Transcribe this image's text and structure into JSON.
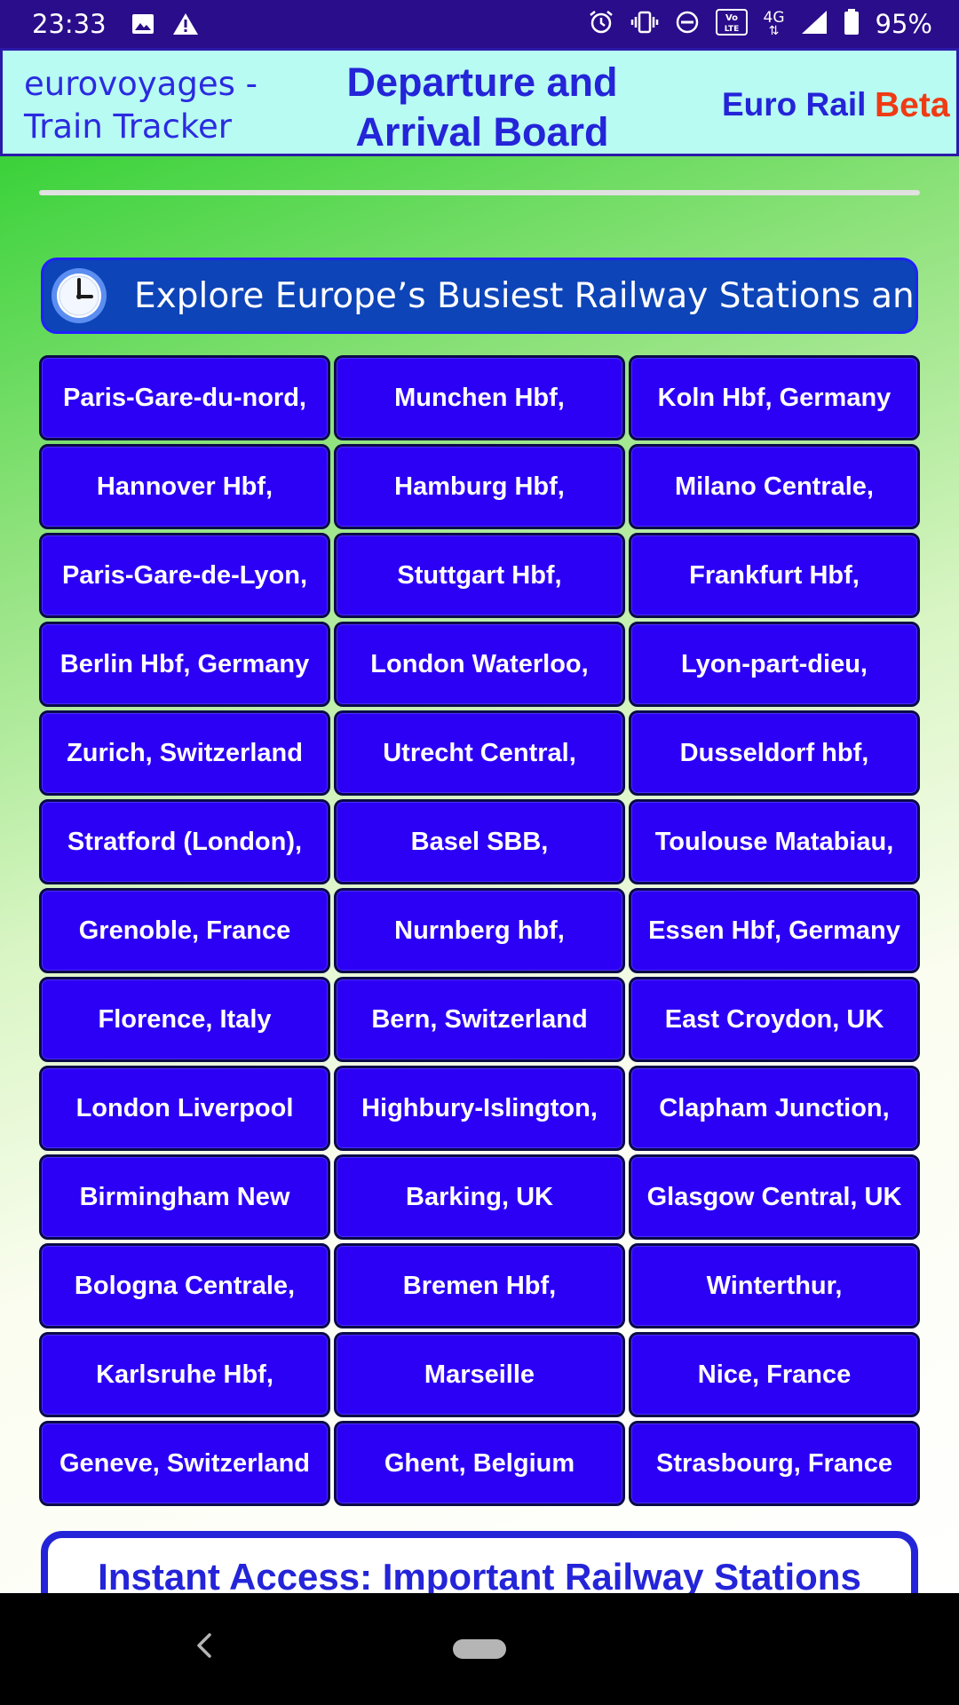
{
  "status_bar": {
    "time": "23:33",
    "battery": "95%",
    "network": "4G",
    "volte": "Vo LTE",
    "icons": [
      "image-icon",
      "warning-icon",
      "alarm-icon",
      "vibrate-icon",
      "do-not-disturb-icon",
      "volte-icon",
      "network-4g-icon",
      "signal-icon",
      "battery-icon"
    ]
  },
  "header": {
    "brand_line1": "eurovoyages -",
    "brand_line2": "Train Tracker",
    "title_line1": "Departure and",
    "title_line2": "Arrival Board",
    "euro_rail": "Euro Rail",
    "beta": "Beta"
  },
  "banner": {
    "text": "Explore Europe’s Busiest Railway Stations and Access"
  },
  "stations": [
    "Paris-Gare-du-nord,",
    "Munchen Hbf,",
    "Koln Hbf, Germany",
    "Hannover Hbf,",
    "Hamburg Hbf,",
    "Milano Centrale,",
    "Paris-Gare-de-Lyon,",
    "Stuttgart Hbf,",
    "Frankfurt Hbf,",
    "Berlin Hbf, Germany",
    "London Waterloo,",
    "Lyon-part-dieu,",
    "Zurich, Switzerland",
    "Utrecht Central,",
    "Dusseldorf hbf,",
    "Stratford (London),",
    "Basel SBB,",
    "Toulouse Matabiau,",
    "Grenoble, France",
    "Nurnberg hbf,",
    "Essen Hbf, Germany",
    "Florence, Italy",
    "Bern, Switzerland",
    "East Croydon, UK",
    "London Liverpool",
    "Highbury-Islington,",
    "Clapham Junction,",
    "Birmingham New",
    "Barking, UK",
    "Glasgow Central, UK",
    "Bologna Centrale,",
    "Bremen Hbf,",
    "Winterthur,",
    "Karlsruhe Hbf,",
    "Marseille",
    "Nice, France",
    "Geneve, Switzerland",
    "Ghent, Belgium",
    "Strasbourg, France"
  ],
  "instant_access": {
    "title": "Instant Access: Important Railway Stations"
  },
  "colors": {
    "status_bar_bg": "#2a0d8a",
    "header_bg": "#b7fbf3",
    "header_text": "#2424d8",
    "beta": "#ef3b14",
    "station_button": "#2c00f5",
    "banner_bg": "#0d44b8"
  }
}
